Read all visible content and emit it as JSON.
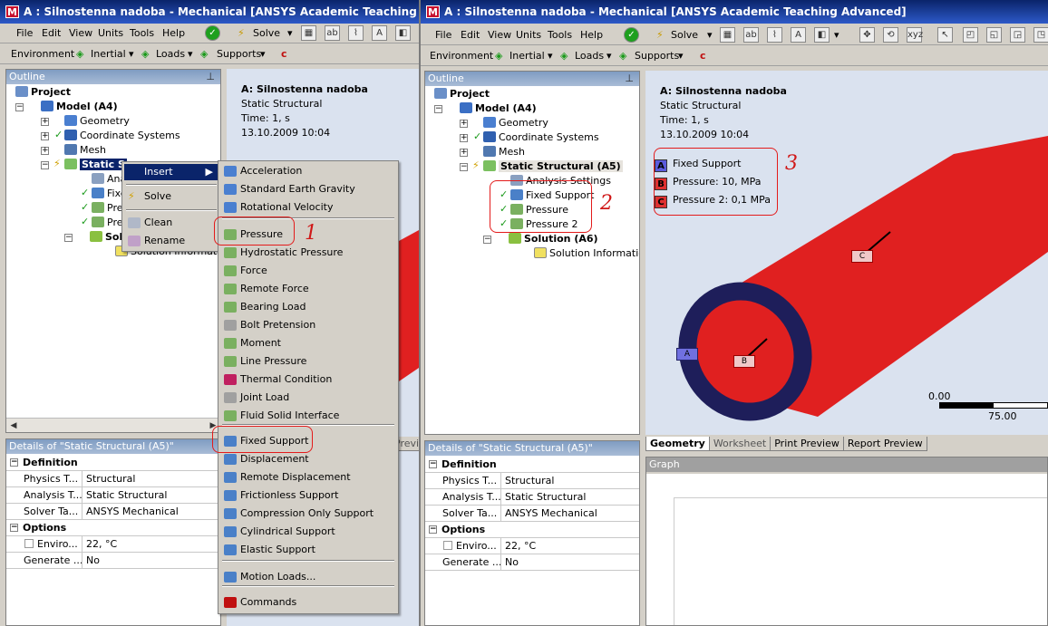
{
  "left": {
    "title": "A : Silnostenna nadoba - Mechanical [ANSYS Academic Teaching Advanced]",
    "menu": [
      "File",
      "Edit",
      "View",
      "Units",
      "Tools",
      "Help"
    ],
    "solve": "Solve",
    "toolbar2": [
      "Environment",
      "Inertial",
      "Loads",
      "Supports"
    ],
    "outline_title": "Outline",
    "tree": {
      "project": "Project",
      "model": "Model (A4)",
      "geometry": "Geometry",
      "coords": "Coordinate Systems",
      "mesh": "Mesh",
      "static": "Static S",
      "ana": "Ana",
      "fixe": "Fixe",
      "pre1": "Pre",
      "pre2": "Pre",
      "solu": "Solu",
      "solinfo": "Solution Information"
    },
    "details_title": "Details of \"Static Structural (A5)\"",
    "details": {
      "def": "Definition",
      "r1k": "Physics T...",
      "r1v": "Structural",
      "r2k": "Analysis T...",
      "r2v": "Static Structural",
      "r3k": "Solver Ta...",
      "r3v": "ANSYS Mechanical",
      "opt": "Options",
      "r4k": "Enviro...",
      "r4v": "22, °C",
      "r5k": "Generate ...",
      "r5v": "No"
    },
    "gfx_title": "A: Silnostenna nadoba",
    "gfx_sub1": "Static Structural",
    "gfx_sub2": "Time: 1, s",
    "gfx_sub3": "13.10.2009 10:04",
    "tab_partial": "Previe"
  },
  "ctx": {
    "insert": "Insert",
    "solve": "Solve",
    "clean": "Clean",
    "rename": "Rename"
  },
  "submenu": [
    "Acceleration",
    "Standard Earth Gravity",
    "Rotational Velocity",
    "Pressure",
    "Hydrostatic Pressure",
    "Force",
    "Remote Force",
    "Bearing Load",
    "Bolt Pretension",
    "Moment",
    "Line Pressure",
    "Thermal Condition",
    "Joint Load",
    "Fluid Solid Interface",
    "Fixed Support",
    "Displacement",
    "Remote Displacement",
    "Frictionless Support",
    "Compression Only Support",
    "Cylindrical Support",
    "Elastic Support",
    "Motion Loads...",
    "Commands"
  ],
  "annot": {
    "n1": "1",
    "n2": "2",
    "n3": "3"
  },
  "right": {
    "title": "A : Silnostenna nadoba - Mechanical [ANSYS Academic Teaching Advanced]",
    "menu": [
      "File",
      "Edit",
      "View",
      "Units",
      "Tools",
      "Help"
    ],
    "solve": "Solve",
    "toolbar2": [
      "Environment",
      "Inertial",
      "Loads",
      "Supports"
    ],
    "outline_title": "Outline",
    "tree": {
      "project": "Project",
      "model": "Model (A4)",
      "geometry": "Geometry",
      "coords": "Coordinate Systems",
      "mesh": "Mesh",
      "static": "Static Structural (A5)",
      "ana": "Analysis Settings",
      "fixed": "Fixed Support",
      "pressure": "Pressure",
      "pressure2": "Pressure 2",
      "solution": "Solution (A6)",
      "solinfo": "Solution Information"
    },
    "details_title": "Details of \"Static Structural (A5)\"",
    "details": {
      "def": "Definition",
      "r1k": "Physics T...",
      "r1v": "Structural",
      "r2k": "Analysis T...",
      "r2v": "Static Structural",
      "r3k": "Solver Ta...",
      "r3v": "ANSYS Mechanical",
      "opt": "Options",
      "r4k": "Enviro...",
      "r4v": "22, °C",
      "r5k": "Generate ...",
      "r5v": "No"
    },
    "gfx_title": "A: Silnostenna nadoba",
    "gfx_sub1": "Static Structural",
    "gfx_sub2": "Time: 1, s",
    "gfx_sub3": "13.10.2009 10:04",
    "legend": [
      {
        "letter": "A",
        "text": "Fixed Support",
        "color": "#5b5bdc"
      },
      {
        "letter": "B",
        "text": "Pressure: 10, MPa",
        "color": "#e03030"
      },
      {
        "letter": "C",
        "text": "Pressure 2: 0,1 MPa",
        "color": "#e03030"
      }
    ],
    "markers": {
      "a": "A",
      "b": "B",
      "c": "C"
    },
    "scale0": "0.00",
    "scale75": "75.00",
    "tabs": [
      "Geometry",
      "Worksheet",
      "Print Preview",
      "Report Preview"
    ],
    "graph_title": "Graph"
  },
  "colors": {
    "cylinder": "#e02020",
    "ring": "#1e1e5a",
    "highlight": "#0a246a"
  }
}
